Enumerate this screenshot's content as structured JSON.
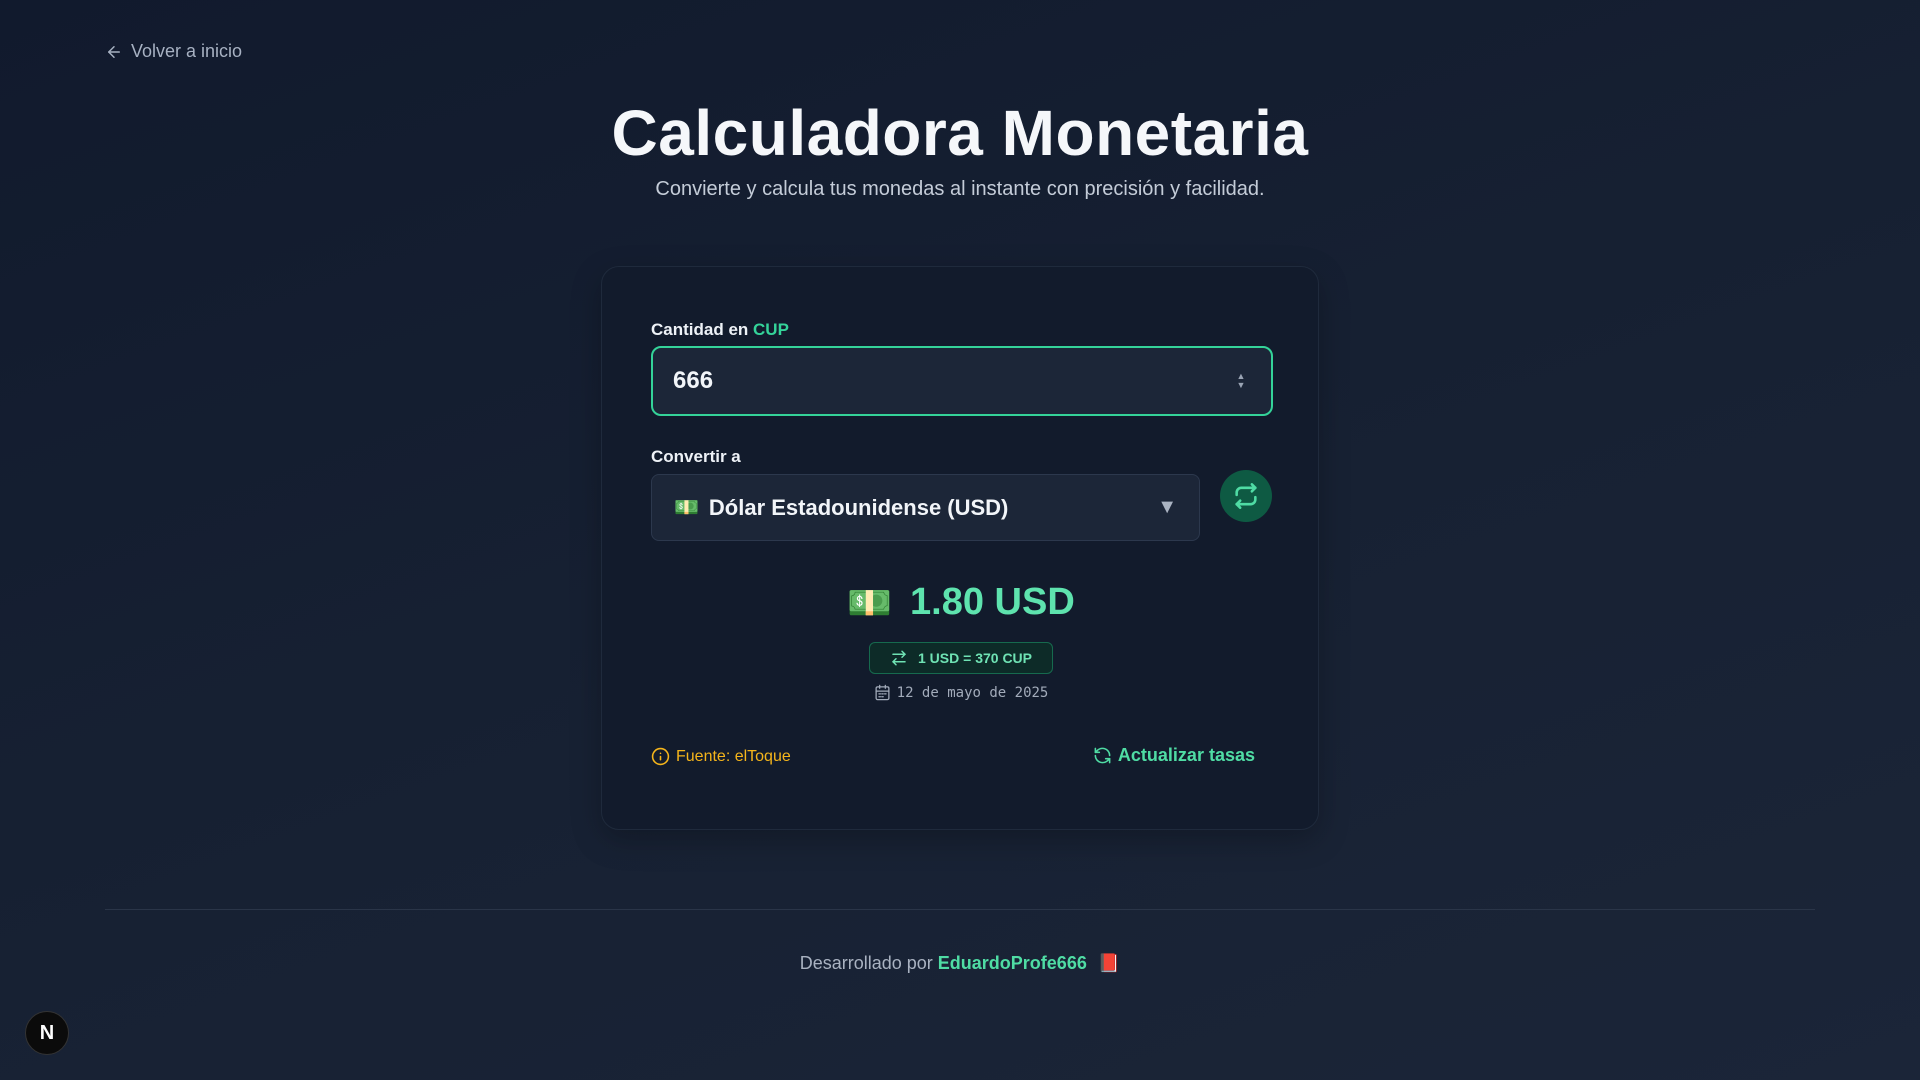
{
  "nav": {
    "back_label": "Volver a inicio"
  },
  "header": {
    "title": "Calculadora Monetaria",
    "subtitle": "Convierte y calcula tus monedas al instante con precisión y facilidad."
  },
  "converter": {
    "amount_label": "Cantidad en",
    "amount_currency": "CUP",
    "amount_value": "666",
    "target_label": "Convertir a",
    "target_flag": "💵",
    "target_selected": "Dólar Estadounidense (USD)",
    "result_icon": "💵",
    "result_value": "1.80 USD",
    "rate_text": "1 USD = 370 CUP",
    "date_text": "12 de mayo de 2025",
    "source_text": "Fuente: elToque",
    "refresh_label": "Actualizar tasas"
  },
  "footer": {
    "prefix": "Desarrollado por",
    "author": "EduardoProfe666",
    "emoji": "📕"
  },
  "next_badge": "N",
  "colors": {
    "accent": "#34d399",
    "warning": "#f5b51b",
    "background": "#111a2d",
    "card": "#121b2c"
  }
}
